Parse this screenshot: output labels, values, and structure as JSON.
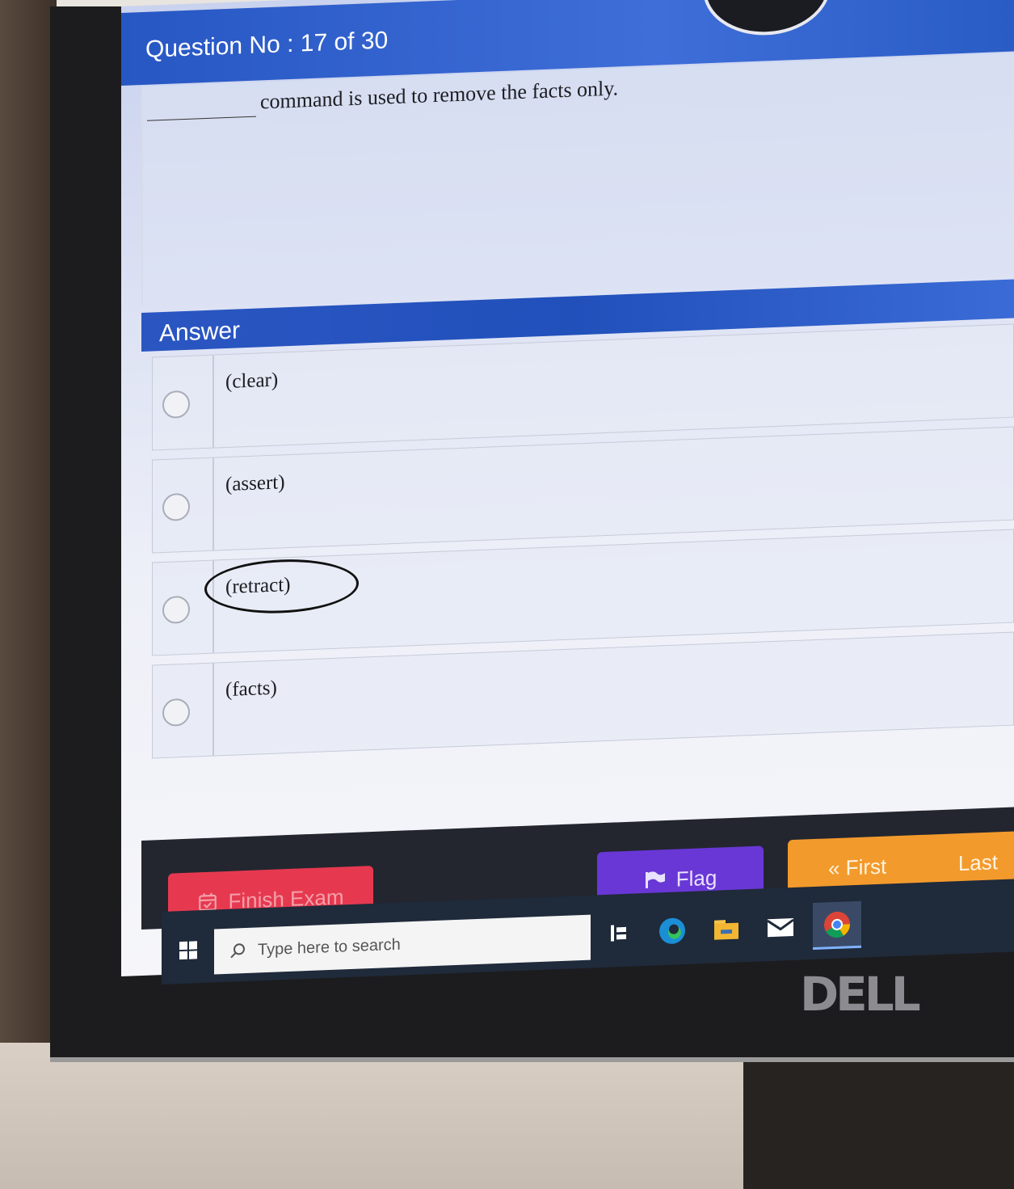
{
  "exam": {
    "question_title": "Question No : 17 of 30",
    "question_text": "command is used to remove the facts only.",
    "answer_title": "Answer",
    "options": [
      {
        "label": "(clear)"
      },
      {
        "label": "(assert)"
      },
      {
        "label": "(retract)"
      },
      {
        "label": "(facts)"
      }
    ]
  },
  "actions": {
    "finish_label": "Finish Exam",
    "flag_label": "Flag",
    "first_label": "« First",
    "last_label": "Last"
  },
  "taskbar": {
    "search_placeholder": "Type here to search",
    "icons": [
      "windows-start-icon",
      "task-view-icon",
      "edge-icon",
      "file-explorer-icon",
      "mail-icon",
      "chrome-icon"
    ]
  },
  "monitor": {
    "brand": "DELL"
  },
  "colors": {
    "header_blue": "#2757c3",
    "finish_red": "#e63950",
    "flag_purple": "#6937d6",
    "nav_orange": "#f39a2c"
  }
}
